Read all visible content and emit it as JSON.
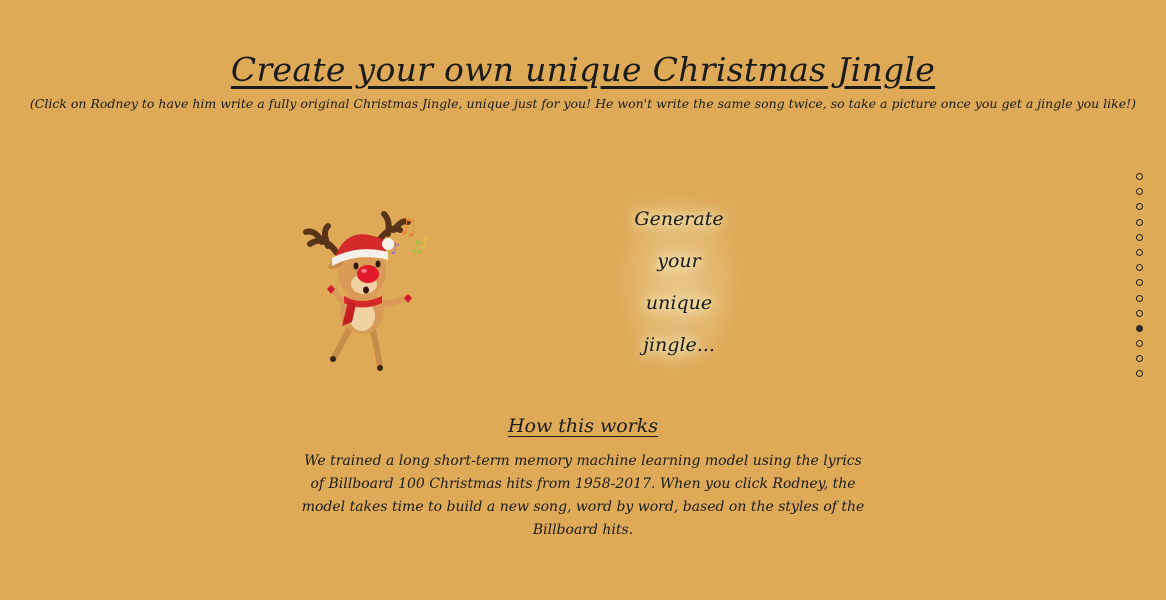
{
  "header": {
    "title": "Create your own unique Christmas Jingle",
    "subtitle": "(Click on Rodney to have him write a fully original Christmas Jingle, unique just for you! He won't write the same song twice, so take a picture once you get a jingle you like!)"
  },
  "generate": {
    "lines": [
      "Generate",
      "your",
      "unique",
      "jingle..."
    ]
  },
  "how": {
    "title": "How this works",
    "body": "We trained a long short-term memory machine learning model using the lyrics of Billboard 100 Christmas hits from 1958-2017. When you click Rodney, the model takes time to build a new song, word by word, based on the styles of the Billboard hits."
  },
  "pagination": {
    "total": 14,
    "active_index": 10
  },
  "icons": {
    "character": "reindeer-icon",
    "notes": "music-notes-icon"
  },
  "colors": {
    "background": "#deaa58",
    "text": "#1b1b1b",
    "nose": "#e0192b",
    "hat": "#d42a2a"
  }
}
